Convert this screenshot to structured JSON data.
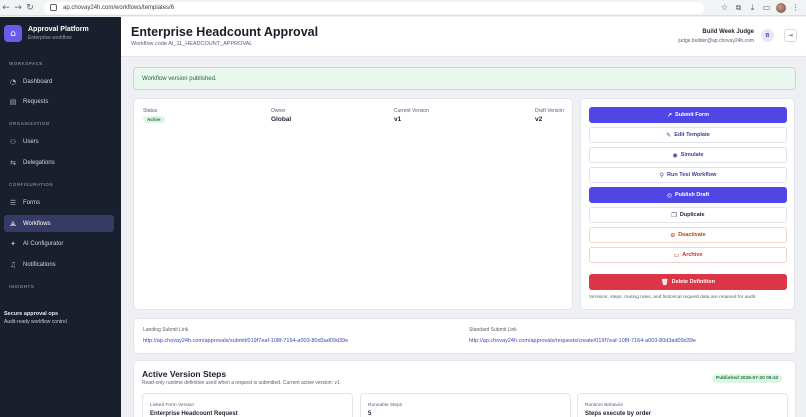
{
  "browser": {
    "url": "ap.chovay24h.com/workflows/templates/6"
  },
  "sidebar": {
    "brand_title": "Approval Platform",
    "brand_subtitle": "Enterprise workflow",
    "sections": {
      "workspace": "WORKSPACE",
      "organization": "ORGANIZATION",
      "configuration": "CONFIGURATION",
      "insights": "INSIGHTS"
    },
    "items": [
      {
        "label": "Dashboard",
        "icon": "dashboard-icon"
      },
      {
        "label": "Requests",
        "icon": "document-icon"
      },
      {
        "label": "Users",
        "icon": "users-icon"
      },
      {
        "label": "Delegations",
        "icon": "swap-icon"
      },
      {
        "label": "Forms",
        "icon": "forms-icon"
      },
      {
        "label": "Workflows",
        "icon": "workflow-icon",
        "active": true
      },
      {
        "label": "AI Configurator",
        "icon": "ai-icon"
      },
      {
        "label": "Notifications",
        "icon": "bell-icon"
      }
    ],
    "footer_title": "Secure approval ops",
    "footer_subtitle": "Audit-ready workflow control"
  },
  "header": {
    "title": "Enterprise Headcount Approval",
    "subtitle": "Workflow code AI_11_HEADCOUNT_APPROVAL",
    "user_name": "Build Week Judge",
    "user_email": "judge.builder@ap.chovay24h.com",
    "user_initial": "B"
  },
  "alert": {
    "message": "Workflow version published."
  },
  "meta": {
    "status_label": "Status",
    "status_value": "Active",
    "owner_label": "Owner",
    "owner_value": "Global",
    "current_label": "Current Version",
    "current_value": "v1",
    "draft_label": "Draft Version",
    "draft_value": "v2"
  },
  "actions": {
    "submit_form": "Submit Form",
    "edit_template": "Edit Template",
    "simulate": "Simulate",
    "run_test": "Run Test Workflow",
    "publish_draft": "Publish Draft",
    "duplicate": "Duplicate",
    "deactivate": "Deactivate",
    "archive": "Archive",
    "delete": "Delete Definition",
    "note": "Versions, steps, routing rules, and historical request data are retained for audit."
  },
  "links": {
    "landing_label": "Landing Submit Link",
    "landing_url": "http://ap.chovay24h.com/approvals/submit/019f7eaf-108f-7164-a003-80d3ad09d39e",
    "standard_label": "Standard Submit Link",
    "standard_url": "http://ap.chovay24h.com/approvals/requests/create/019f7eaf-108f-7164-a003-80d3ad09d39e"
  },
  "steps": {
    "title": "Active Version Steps",
    "subtitle": "Read-only runtime definition used when a request is submitted. Current active version: v1",
    "badge": "Published 2026-07-20 09:42",
    "cards": [
      {
        "label": "Linked Form Version",
        "value": "Enterprise Headcount Request"
      },
      {
        "label": "Runnable Steps",
        "value": "5"
      },
      {
        "label": "Runtime Behavior",
        "value": "Steps execute by order"
      }
    ]
  },
  "colors": {
    "sidebar_bg": "#1a1f2e",
    "primary": "#4f46e5",
    "danger": "#dc3545",
    "success_bg": "#eaf7ef"
  }
}
